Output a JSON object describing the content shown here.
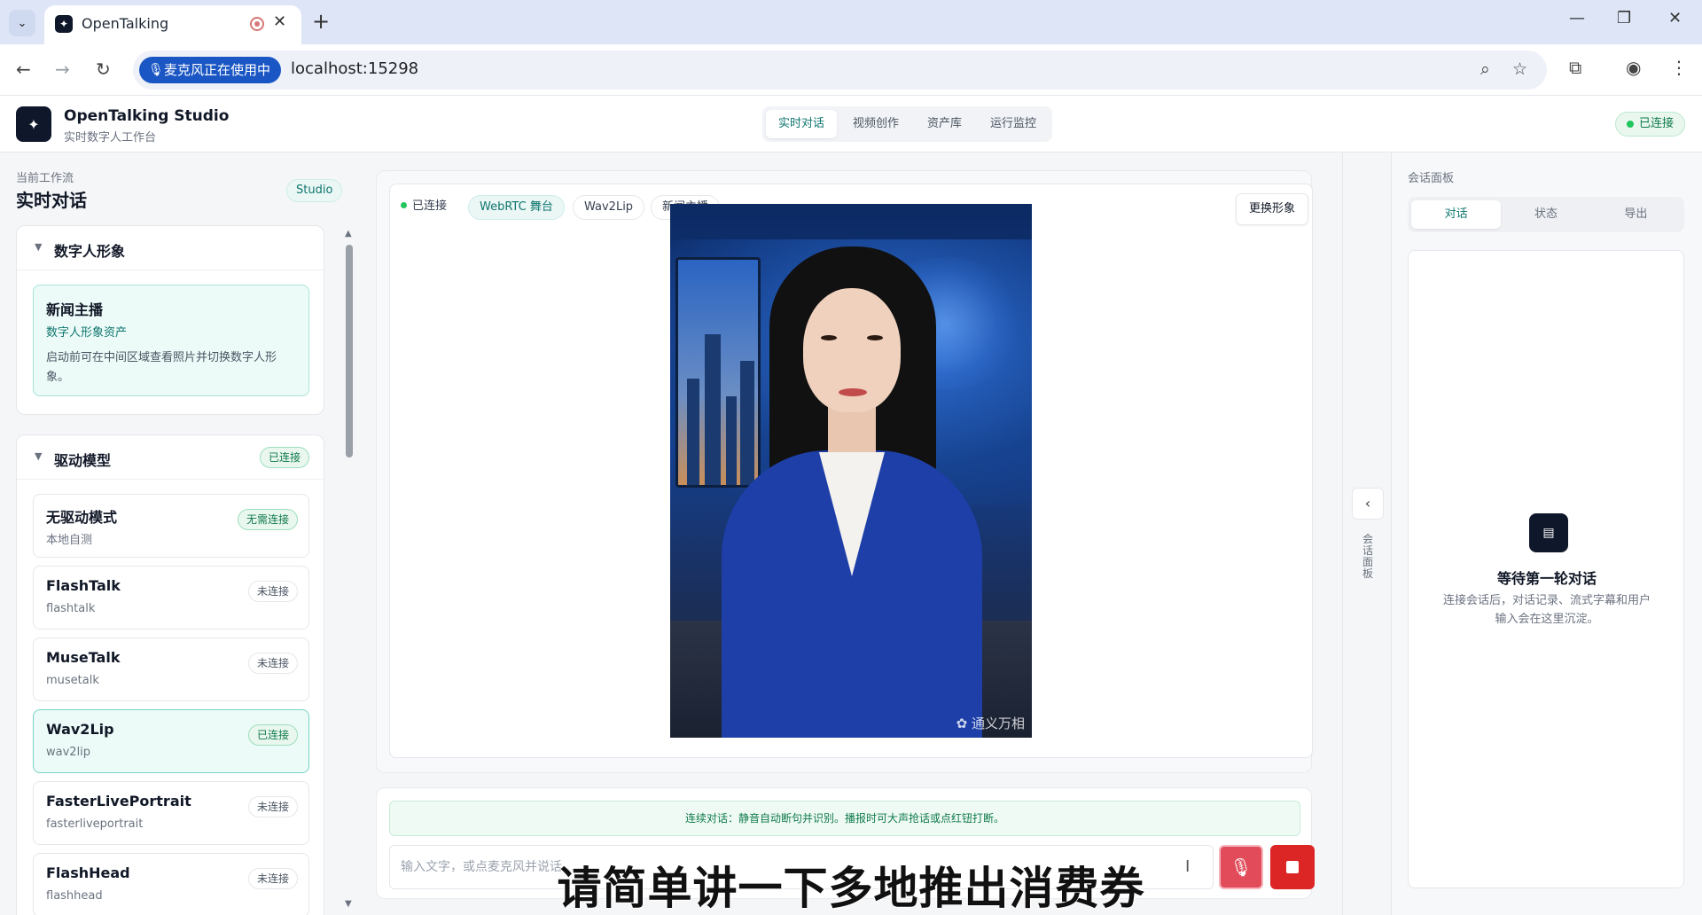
{
  "browser": {
    "tab_title": "OpenTalking",
    "tab_close": "✕",
    "new_tab": "+",
    "mic_in_use": "麦克风正在使用中",
    "url": "localhost:15298",
    "window_min": "—",
    "window_restore": "❐",
    "window_close": "✕"
  },
  "app": {
    "brand": "OpenTalking Studio",
    "brand_sub": "实时数字人工作台",
    "nav": [
      "实时对话",
      "视频创作",
      "资产库",
      "运行监控"
    ],
    "active_nav": "实时对话",
    "connection_status": "已连接"
  },
  "sidebar": {
    "workflow_label": "当前工作流",
    "workflow_title": "实时对话",
    "studio_tag": "Studio",
    "avatar_section": {
      "title": "数字人形象",
      "item_name": "新闻主播",
      "item_sub": "数字人形象资产",
      "item_desc": "启动前可在中间区域查看照片并切换数字人形象。"
    },
    "model_section": {
      "title": "驱动模型",
      "status": "已连接",
      "models": [
        {
          "name": "无驱动模式",
          "sub": "本地自测",
          "status": "无需连接",
          "selected": false,
          "connected": true
        },
        {
          "name": "FlashTalk",
          "sub": "flashtalk",
          "status": "未连接",
          "selected": false,
          "connected": false
        },
        {
          "name": "MuseTalk",
          "sub": "musetalk",
          "status": "未连接",
          "selected": false,
          "connected": false
        },
        {
          "name": "Wav2Lip",
          "sub": "wav2lip",
          "status": "已连接",
          "selected": true,
          "connected": true
        },
        {
          "name": "FasterLivePortrait",
          "sub": "fasterliveportrait",
          "status": "未连接",
          "selected": false,
          "connected": false
        },
        {
          "name": "FlashHead",
          "sub": "flashhead",
          "status": "未连接",
          "selected": false,
          "connected": false
        }
      ]
    }
  },
  "stage": {
    "chips": {
      "connected": "已连接",
      "transport": "WebRTC 舞台",
      "model": "Wav2Lip",
      "avatar": "新闻主播"
    },
    "swap_avatar": "更换形象",
    "watermark": "通义万相"
  },
  "composer": {
    "hint": "连续对话：静音自动断句并识别。播报时可大声抢话或点红钮打断。",
    "placeholder": "输入文字，或点麦克风并说话…"
  },
  "subtitle": "请简单讲一下多地推出消费券",
  "right_panel": {
    "rail_label": "会话面板",
    "label": "会话面板",
    "tabs": [
      "对话",
      "状态",
      "导出"
    ],
    "active_tab": "对话",
    "empty_title": "等待第一轮对话",
    "empty_desc": "连接会话后，对话记录、流式字幕和用户输入会在这里沉淀。"
  }
}
